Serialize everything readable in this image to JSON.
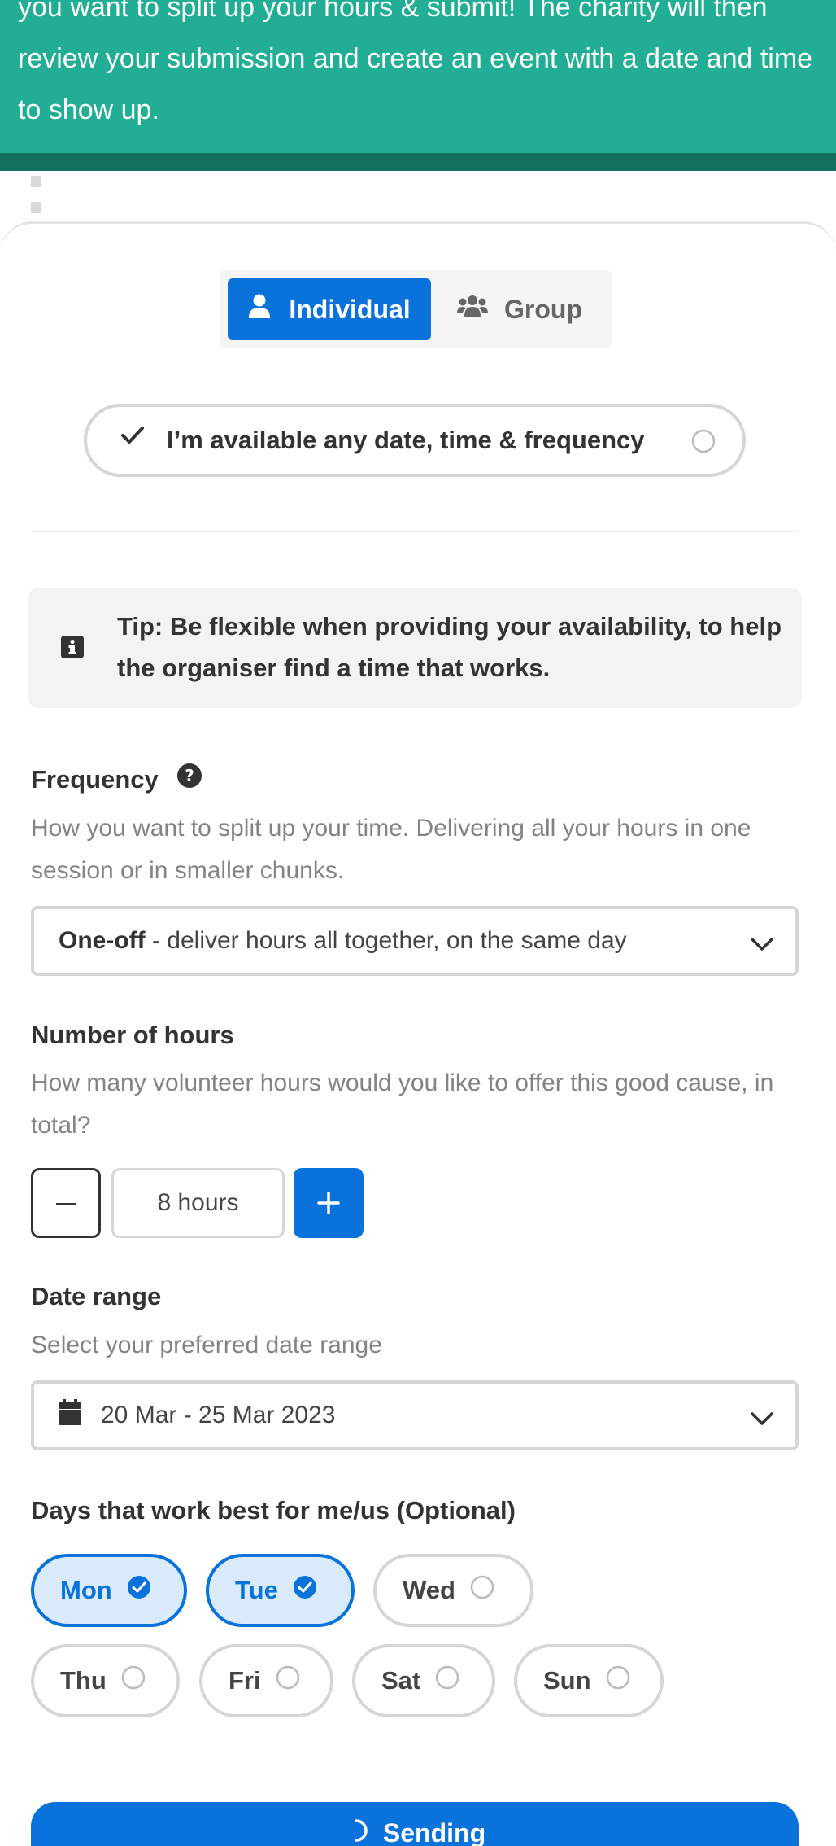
{
  "banner": {
    "text": "you want to split up your hours & submit! The charity will then review your submission and create an event with a date and time to show up."
  },
  "mode_toggle": {
    "individual_label": "Individual",
    "group_label": "Group",
    "selected": "Individual"
  },
  "availability": {
    "any_label": "I’m available any date, time & frequency"
  },
  "tip": {
    "text": "Tip: Be flexible when providing your availability, to help the organiser find a time that works."
  },
  "frequency": {
    "label": "Frequency",
    "description": "How you want to split up your time. Delivering all your hours in one session or in smaller chunks.",
    "selected_bold": "One-off",
    "selected_rest": " - deliver hours all together, on the same day"
  },
  "hours": {
    "label": "Number of hours",
    "description": "How many volunteer hours would you like to offer this good cause, in total?",
    "value": "8 hours"
  },
  "date_range": {
    "label": "Date range",
    "description": "Select your preferred date range",
    "value": "20 Mar - 25 Mar 2023"
  },
  "days": {
    "label": "Days that work best for me/us (Optional)",
    "items": [
      {
        "label": "Mon",
        "selected": true
      },
      {
        "label": "Tue",
        "selected": true
      },
      {
        "label": "Wed",
        "selected": false
      },
      {
        "label": "Thu",
        "selected": false
      },
      {
        "label": "Fri",
        "selected": false
      },
      {
        "label": "Sat",
        "selected": false
      },
      {
        "label": "Sun",
        "selected": false
      }
    ]
  },
  "submit": {
    "label": "Sending"
  },
  "colors": {
    "banner": "#21ae94",
    "banner_strip": "#12705e",
    "primary": "#0a73db",
    "selected_day_bg": "#d9ebfb"
  }
}
